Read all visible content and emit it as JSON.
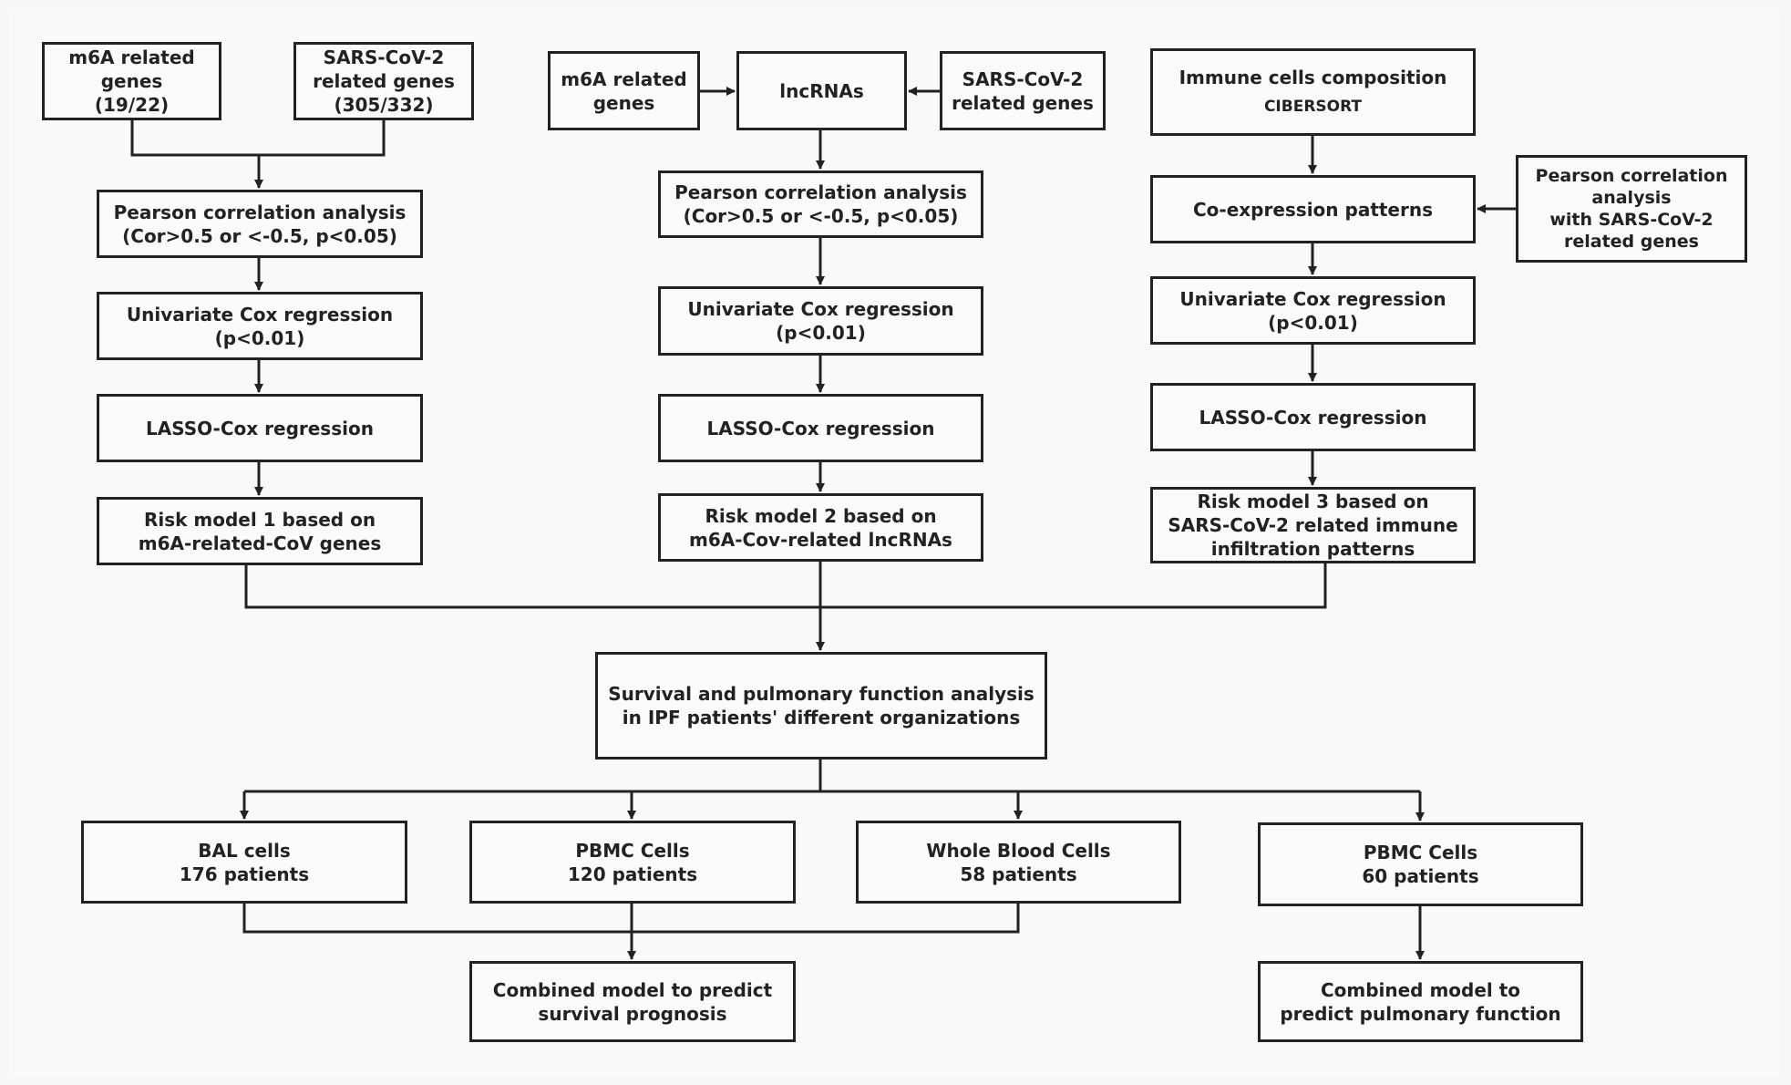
{
  "column_1": {
    "m6a_genes": [
      "m6A related",
      "genes",
      "(19/22)"
    ],
    "sars_genes": [
      "SARS-CoV-2",
      "related genes",
      "(305/332)"
    ],
    "pearson": [
      "Pearson correlation analysis",
      "(Cor>0.5 or <-0.5, p<0.05)"
    ],
    "univariate": [
      "Univariate Cox regression",
      "(p<0.01)"
    ],
    "lasso": [
      "LASSO-Cox regression"
    ],
    "risk_model": [
      "Risk model 1 based on",
      "m6A-related-CoV genes"
    ]
  },
  "column_2": {
    "m6a_genes": [
      "m6A related",
      "genes"
    ],
    "lncrnas": [
      "lncRNAs"
    ],
    "sars_genes": [
      "SARS-CoV-2",
      "related genes"
    ],
    "pearson": [
      "Pearson correlation analysis",
      "(Cor>0.5 or <-0.5, p<0.05)"
    ],
    "univariate": [
      "Univariate Cox regression",
      "(p<0.01)"
    ],
    "lasso": [
      "LASSO-Cox regression"
    ],
    "risk_model": [
      "Risk model 2 based on",
      "m6A-Cov-related lncRNAs"
    ]
  },
  "column_3": {
    "immune": {
      "title": "Immune cells composition",
      "subtitle": "CIBERSORT"
    },
    "coexpression": [
      "Co-expression patterns"
    ],
    "pearson_side": [
      "Pearson correlation",
      "analysis",
      "with SARS-CoV-2",
      "related genes"
    ],
    "univariate": [
      "Univariate Cox regression",
      "(p<0.01)"
    ],
    "lasso": [
      "LASSO-Cox regression"
    ],
    "risk_model": [
      "Risk model 3 based on",
      "SARS-CoV-2 related immune",
      "infiltration patterns"
    ]
  },
  "survival": [
    "Survival and pulmonary function analysis",
    "in  IPF patients'  different organizations"
  ],
  "cohorts": [
    {
      "name": "BAL cells",
      "patients": "176 patients"
    },
    {
      "name": "PBMC Cells",
      "patients": "120 patients"
    },
    {
      "name": "Whole Blood Cells",
      "patients": "58 patients"
    },
    {
      "name": "PBMC Cells",
      "patients": "60 patients"
    }
  ],
  "outcomes": {
    "survival": [
      "Combined model to predict",
      "survival prognosis"
    ],
    "pulmonary": [
      "Combined model to",
      "predict pulmonary function"
    ]
  },
  "colors": {
    "line": "#222222",
    "box_fill": "#fafafa",
    "background": "#f7f7f7"
  }
}
